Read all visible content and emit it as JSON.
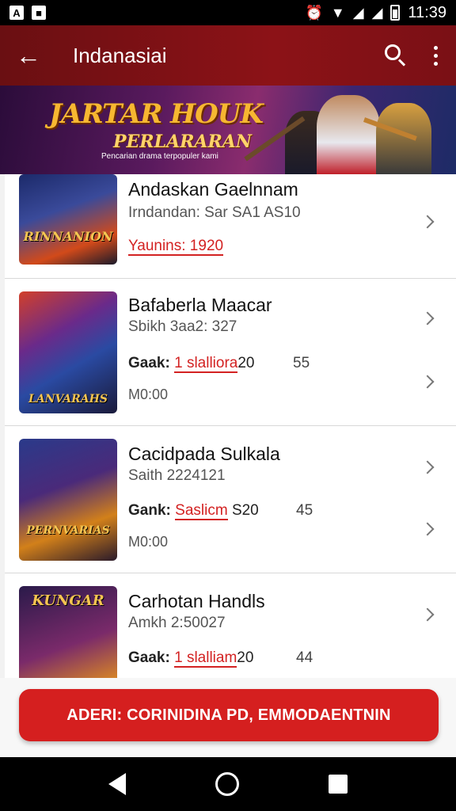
{
  "status_bar": {
    "time": "11:39"
  },
  "app_bar": {
    "title": "Indanasiai"
  },
  "banner": {
    "title": "JARTAR HOUK",
    "subtitle": "PERLARARAN",
    "caption": "Pencarian drama terpopuler kami"
  },
  "cards": [
    {
      "title": "Andaskan Gaelnnam",
      "subtitle": "Irndandan: Sar SA1 AS10",
      "line_value": "Yaunins: 1920",
      "thumb_label": "RINNANION"
    },
    {
      "title": "Bafaberla Maacar",
      "subtitle": "Sbikh 3aa2: 327",
      "line_prefix": "Gaak:",
      "line_red": "1 slalliora",
      "line_after": "20",
      "line_num": "55",
      "extra": "M0:00",
      "thumb_label": "LANVARAHS"
    },
    {
      "title": "Cacidpada Sulkala",
      "subtitle": "Saith 2224121",
      "line_prefix": "Gank:",
      "line_red": "Saslicm",
      "line_after": "S20",
      "line_num": "45",
      "extra": "M0:00",
      "thumb_label": "PERNVARIAS"
    },
    {
      "title": "Carhotan Handls",
      "subtitle": "Amkh 2:50027",
      "line_prefix": "Gaak:",
      "line_red": "1 slalliam",
      "line_after": "20",
      "line_num": "44",
      "thumb_label": "KUNGAR"
    }
  ],
  "cta": {
    "label": "ADERI: CORINIDINA PD, EMMODAENTNIN"
  },
  "colors": {
    "primary": "#8c1217",
    "accent": "#d51f1f"
  }
}
